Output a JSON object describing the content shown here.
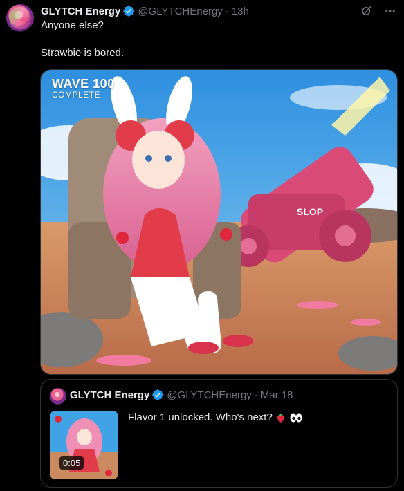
{
  "tweet": {
    "author_name": "GLYTCH Energy",
    "handle": "@GLYTCHEnergy",
    "separator": "·",
    "time": "13h",
    "text_line1": "Anyone else?",
    "text_line2": "Strawbie is bored.",
    "media": {
      "overlay_line1": "WAVE 100",
      "overlay_line2": "COMPLETE",
      "cannon_label": "SLOP"
    }
  },
  "quoted": {
    "author_name": "GLYTCH Energy",
    "handle": "@GLYTCHEnergy",
    "separator": "·",
    "date": "Mar 18",
    "text": "Flavor 1 unlocked. Who's next?",
    "duration": "0:05"
  },
  "icons": {
    "verified": "verified-badge-icon",
    "grok": "grok-icon",
    "more": "more-icon",
    "strawberry": "strawberry-emoji",
    "eyes": "eyes-emoji"
  },
  "colors": {
    "background": "#000000",
    "text": "#e7e9ea",
    "muted": "#71767b",
    "verified_blue": "#1d9bf0",
    "border": "#2f3336"
  }
}
